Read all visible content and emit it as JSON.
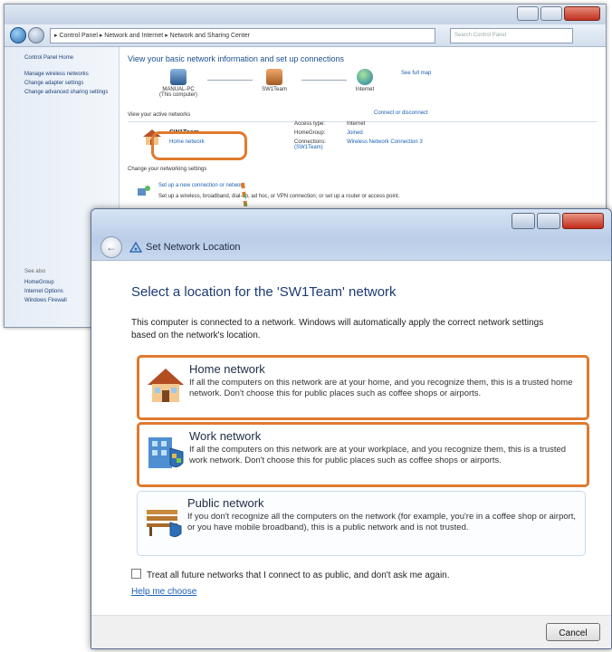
{
  "background_window": {
    "breadcrumb": "▸ Control Panel ▸ Network and Internet ▸ Network and Sharing Center",
    "search_placeholder": "Search Control Panel",
    "sidebar_top": [
      "Control Panel Home",
      "Manage wireless networks",
      "Change adapter settings",
      "Change advanced sharing settings"
    ],
    "sidebar_bottom_heading": "See also",
    "sidebar_bottom": [
      "HomeGroup",
      "Internet Options",
      "Windows Firewall"
    ],
    "heading": "View your basic network information and set up connections",
    "see_full_map": "See full map",
    "nodes": [
      {
        "label": "MANUAL-PC",
        "sub": "(This computer)"
      },
      {
        "label": "SW1Team",
        "sub": ""
      },
      {
        "label": "Internet",
        "sub": ""
      }
    ],
    "active_networks_label": "View your active networks",
    "connect_link": "Connect or disconnect",
    "network_name": "SW1Team",
    "network_type": "Home network",
    "access_type_label": "Access type:",
    "access_type_value": "Internet",
    "homegroup_label": "HomeGroup:",
    "homegroup_value": "Joined",
    "connections_label": "Connections:",
    "connections_value": "Wireless Network Connection 3 (SW1Team)",
    "change_settings_label": "Change your networking settings",
    "setup_title": "Set up a new connection or network",
    "setup_desc": "Set up a wireless, broadband, dial-up, ad hoc, or VPN connection; or set up a router or access point."
  },
  "dialog": {
    "title": "Set Network Location",
    "question": "Select a location for the 'SW1Team' network",
    "intro": "This computer is connected to a network. Windows will automatically apply the correct network settings based on the network's location.",
    "options": [
      {
        "name": "Home network",
        "desc": "If all the computers on this network are at your home, and you recognize them, this is a trusted home network.  Don't choose this for public places such as coffee shops or airports."
      },
      {
        "name": "Work network",
        "desc": "If all the computers on this network are at your workplace, and you recognize them, this is a trusted work network.  Don't choose this for public places such as coffee shops or airports."
      },
      {
        "name": "Public network",
        "desc": "If you don't recognize all the computers on the network (for example, you're in a coffee shop or airport, or you have mobile broadband), this is a public network and is not trusted."
      }
    ],
    "checkbox_label": "Treat all future networks that I connect to as public, and don't ask me again.",
    "help_link": "Help me choose",
    "cancel_label": "Cancel"
  },
  "colors": {
    "highlight": "#e07a2e",
    "title_blue": "#1c3a74",
    "link_blue": "#1a5fb4"
  }
}
